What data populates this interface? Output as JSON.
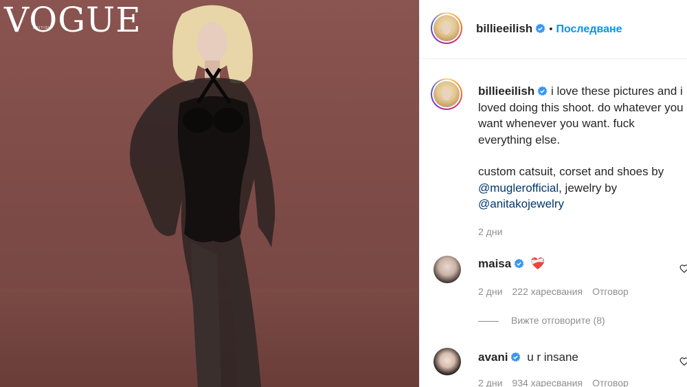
{
  "photo": {
    "magazine_title": "VOGUE",
    "magazine_edition": "BRITISH"
  },
  "post": {
    "username": "billieeilish",
    "follow_label": "Последване",
    "caption": {
      "line1": "i love these pictures and i loved doing this shoot. do whatever you want whenever you want. fuck everything else.",
      "line2_prefix": "custom catsuit, corset and shoes by ",
      "mention1": "@muglerofficial",
      "line2_middle": ", jewelry by ",
      "mention2": "@anitakojewelry",
      "time": "2 дни"
    },
    "comments": [
      {
        "username": "maisa",
        "text": "❤️‍🩹",
        "time": "2 дни",
        "likes": "222 харесвания",
        "reply_label": "Отговор",
        "view_replies": "Вижте отговорите (8)"
      },
      {
        "username": "avani",
        "text": "u r insane",
        "time": "2 дни",
        "likes": "934 харесвания",
        "reply_label": "Отговор"
      }
    ]
  },
  "colors": {
    "accent_blue": "#0095f6",
    "mention": "#00376b",
    "muted": "#8e8e8e",
    "verified": "#3897f0"
  },
  "icons": [
    "verified-badge-icon",
    "heart-icon"
  ]
}
